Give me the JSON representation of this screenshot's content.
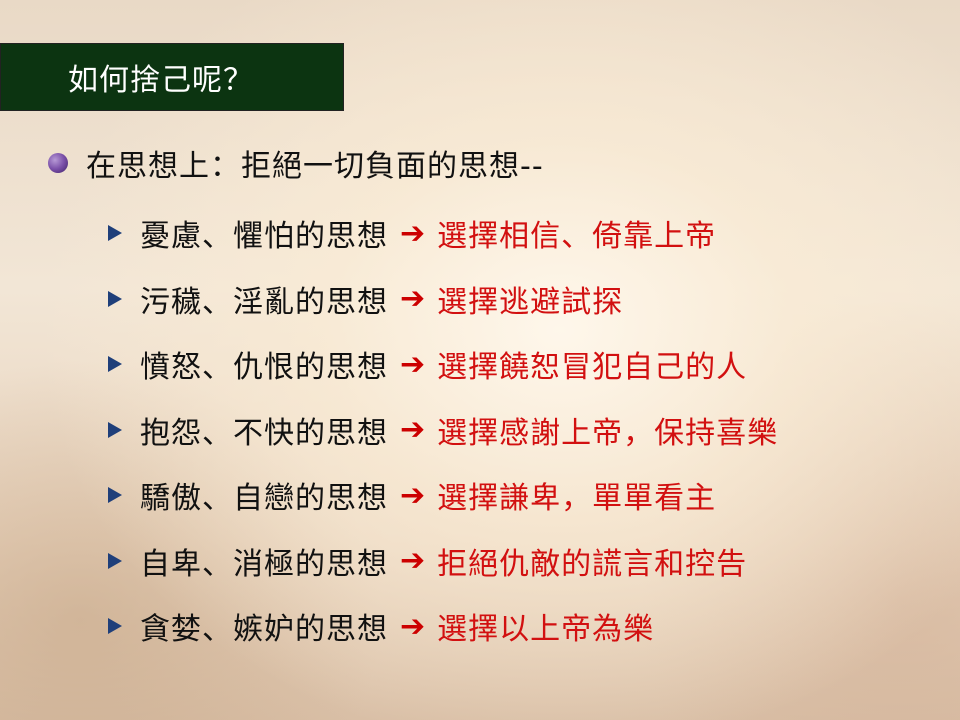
{
  "title": "如何捨己呢？",
  "main_point": "在思想上：拒絕一切負面的思想--",
  "arrow_symbol": "➔",
  "items": [
    {
      "left": "憂慮、懼怕的思想",
      "right": "選擇相信、倚靠上帝"
    },
    {
      "left": "污穢、淫亂的思想",
      "right": "選擇逃避試探"
    },
    {
      "left": "憤怒、仇恨的思想",
      "right": "選擇饒恕冒犯自己的人"
    },
    {
      "left": "抱怨、不快的思想",
      "right": "選擇感謝上帝，保持喜樂"
    },
    {
      "left": "驕傲、自戀的思想",
      "right": "選擇謙卑，單單看主"
    },
    {
      "left": "自卑、消極的思想",
      "right": "拒絕仇敵的謊言和控告"
    },
    {
      "left": "貪婪、嫉妒的思想",
      "right": "選擇以上帝為樂"
    }
  ],
  "colors": {
    "title_bg": "#0c3411",
    "accent_red": "#d21010",
    "bullet_blue": "#1f3f7a",
    "bullet_purple": "#7a4fa8"
  }
}
